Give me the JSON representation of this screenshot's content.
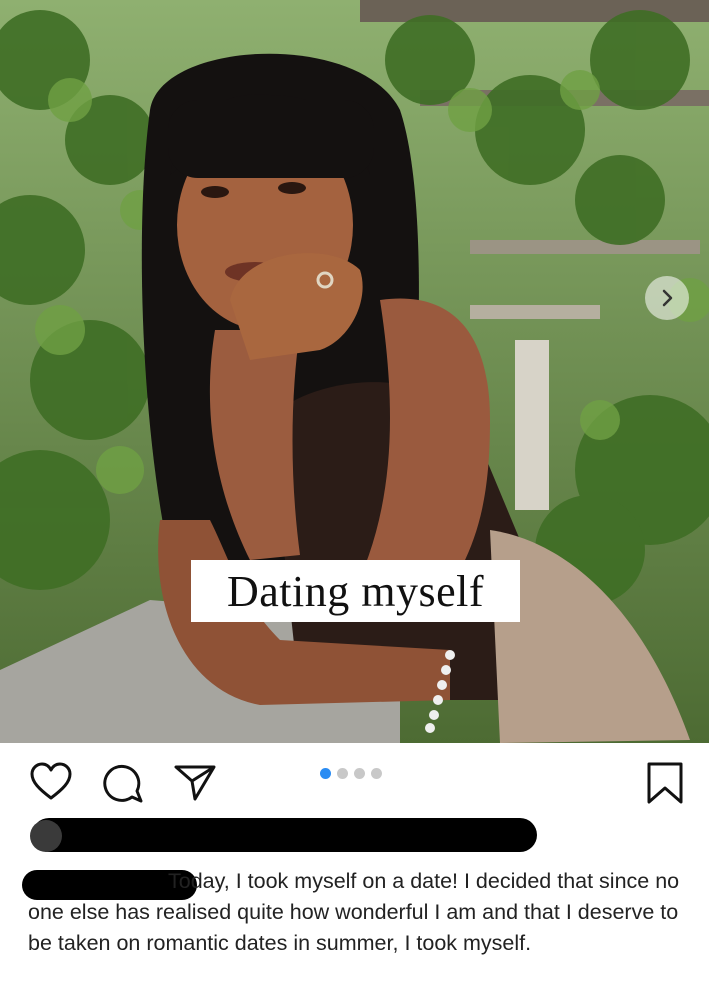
{
  "post": {
    "image_alt": "Woman leaning on a stone ledge under a leafy pergola",
    "overlay_text": "Dating myself",
    "carousel": {
      "count": 4,
      "active_index": 0
    },
    "caption_text": "Today, I took myself on a date! I decided that since no one else has realised quite how wonderful I am and that I deserve to be taken on romantic dates in summer, I took myself.",
    "username_redacted": true,
    "liked_by_redacted": true
  },
  "actions": {
    "icons": [
      "heart-icon",
      "comment-icon",
      "share-icon",
      "bookmark-icon"
    ]
  },
  "colors": {
    "accent": "#2a8cf3",
    "dot_inactive": "#c8c8c8",
    "text": "#222222"
  }
}
